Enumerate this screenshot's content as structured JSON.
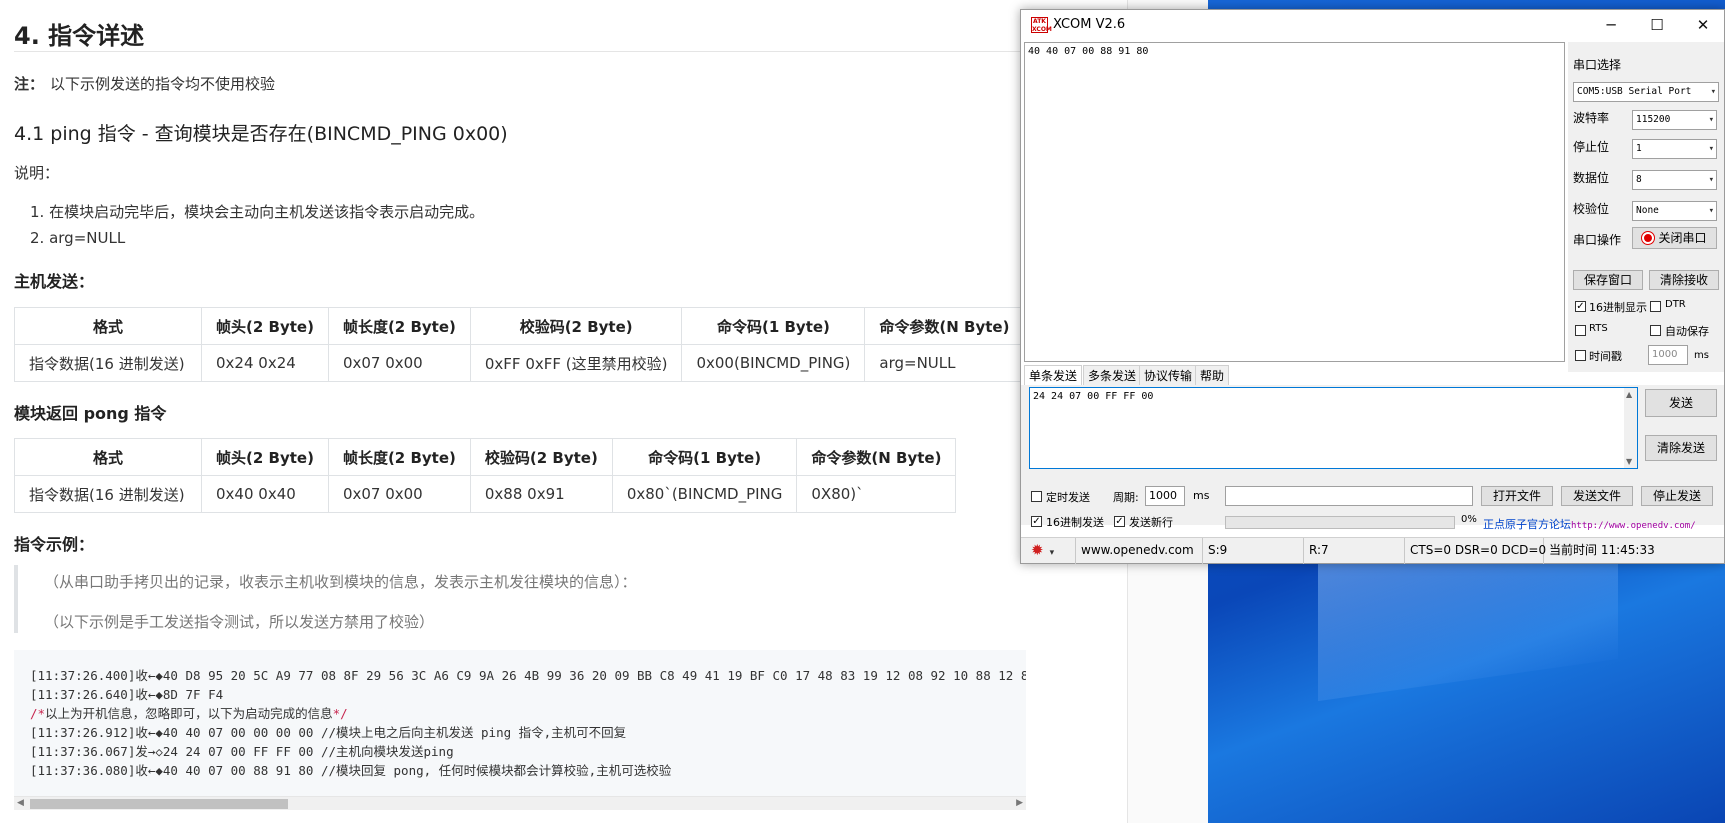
{
  "doc": {
    "h2": "4. 指令详述",
    "note_label": "注：",
    "note_text": "以下示例发送的指令均不使用校验",
    "h3": "4.1 ping 指令 - 查询模块是否存在(BINCMD_PING 0x00)",
    "explain_label": "说明：",
    "items": [
      "1. 在模块启动完毕后，模块会主动向主机发送该指令表示启动完成。",
      "2. arg=NULL"
    ],
    "host_send_title": "主机发送：",
    "table1": {
      "headers": [
        "格式",
        "帧头(2 Byte)",
        "帧长度(2 Byte)",
        "校验码(2 Byte)",
        "命令码(1 Byte)",
        "命令参数(N Byte)"
      ],
      "row": [
        "指令数据(16 进制发送)",
        "0x24 0x24",
        "0x07 0x00",
        "0xFF 0xFF (这里禁用校验)",
        "0x00(BINCMD_PING)",
        "arg=NULL"
      ]
    },
    "module_return_title": "模块返回 pong 指令",
    "table2": {
      "headers": [
        "格式",
        "帧头(2 Byte)",
        "帧长度(2 Byte)",
        "校验码(2 Byte)",
        "命令码(1 Byte)",
        "命令参数(N Byte)"
      ],
      "row": [
        "指令数据(16 进制发送)",
        "0x40 0x40",
        "0x07 0x00",
        "0x88 0x91",
        "0x80`(BINCMD_PING",
        "0X80)`"
      ]
    },
    "example_title": "指令示例：",
    "quote": [
      "（从串口助手拷贝出的记录，收表示主机收到模块的信息，发表示主机发往模块的信息）：",
      "（以下示例是手工发送指令测试，所以发送方禁用了校验）"
    ],
    "code": [
      "[11:37:26.400]收←◆40 D8 95 20 5C A9 77 08 8F 29 56 3C A6 C9 9A 26 4B 99 36 20 09 BB C8 49 41 19 BF C0 17 48 83 19 12 08 92 10 88 12 8",
      "[11:37:26.640]收←◆8D 7F F4",
      "以上为开机信息，忽略即可，以下为启动完成的信息",
      "[11:37:26.912]收←◆40 40 07 00 00 00 00 //模块上电之后向主机发送 ping 指令,主机可不回复",
      "[11:37:36.067]发→◇24 24 07 00 FF FF 00 //主机向模块发送ping",
      "[11:37:36.080]收←◆40 40 07 00 88 91 80 //模块回复 pong, 任何时候模块都会计算校验,主机可选校验"
    ],
    "comment_open": "/*",
    "comment_close": "*/"
  },
  "xcom": {
    "icon_text": "ATK XCOM",
    "title": "XCOM V2.6",
    "minimize": "─",
    "maximize": "☐",
    "close": "✕",
    "recv_text": "40 40 07 00 88 91 80",
    "port_select_label": "串口选择",
    "port_value": "COM5:USB Serial Port",
    "baud_label": "波特率",
    "baud_value": "115200",
    "stop_label": "停止位",
    "stop_value": "1",
    "data_label": "数据位",
    "data_value": "8",
    "parity_label": "校验位",
    "parity_value": "None",
    "port_op_label": "串口操作",
    "close_port_btn": "关闭串口",
    "save_window_btn": "保存窗口",
    "clear_recv_btn": "清除接收",
    "hex_display_label": "16进制显示",
    "hex_display_checked": true,
    "dtr_label": "DTR",
    "rts_label": "RTS",
    "auto_save_label": "自动保存",
    "timestamp_label": "时间戳",
    "timestamp_ms_value": "1000",
    "ms_unit": "ms",
    "tabs": [
      "单条发送",
      "多条发送",
      "协议传输",
      "帮助"
    ],
    "send_text": "24 24 07 00 FF FF 00",
    "send_btn": "发送",
    "clear_send_btn": "清除发送",
    "timed_send_label": "定时发送",
    "period_label": "周期:",
    "period_value": "1000",
    "period_unit": "ms",
    "open_file_btn": "打开文件",
    "send_file_btn": "发送文件",
    "stop_send_btn": "停止发送",
    "hex_send_label": "16进制发送",
    "hex_send_checked": true,
    "send_newline_label": "发送新行",
    "send_newline_checked": true,
    "progress_percent": "0%",
    "forum_link_text": "正点原子官方论坛",
    "forum_url_text": "http://www.openedv.com/",
    "status": {
      "website": "www.openedv.com",
      "sent": "S:9",
      "recv": "R:7",
      "lines": "CTS=0 DSR=0 DCD=0",
      "time": "当前时间 11:45:33"
    }
  }
}
